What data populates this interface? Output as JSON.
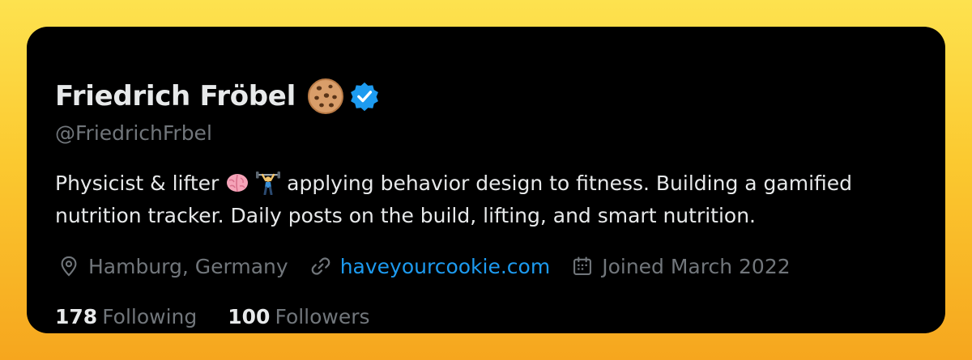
{
  "profile": {
    "display_name": "Friedrich Fröbel",
    "name_emoji": "cookie",
    "verified": true,
    "handle": "@FriedrichFrbel"
  },
  "bio": {
    "line1_before": "Physicist & lifter",
    "line1_emojis": [
      "brain",
      "weight-lifter"
    ],
    "line1_after": "applying behavior design to fitness. Building a gamified",
    "line2": "nutrition tracker. Daily posts on the build, lifting, and smart nutrition."
  },
  "meta": {
    "location": "Hamburg, Germany",
    "website": "haveyourcookie.com",
    "joined": "Joined March 2022"
  },
  "stats": {
    "following_count": "178",
    "following_label": "Following",
    "followers_count": "100",
    "followers_label": "Followers"
  },
  "colors": {
    "background_top": "#fde24f",
    "background_bottom": "#f6a61e",
    "card": "#000000",
    "primary_text": "#e7e9ea",
    "secondary_text": "#71767b",
    "link": "#1d9bf0",
    "verified_badge": "#1d9bf0"
  }
}
